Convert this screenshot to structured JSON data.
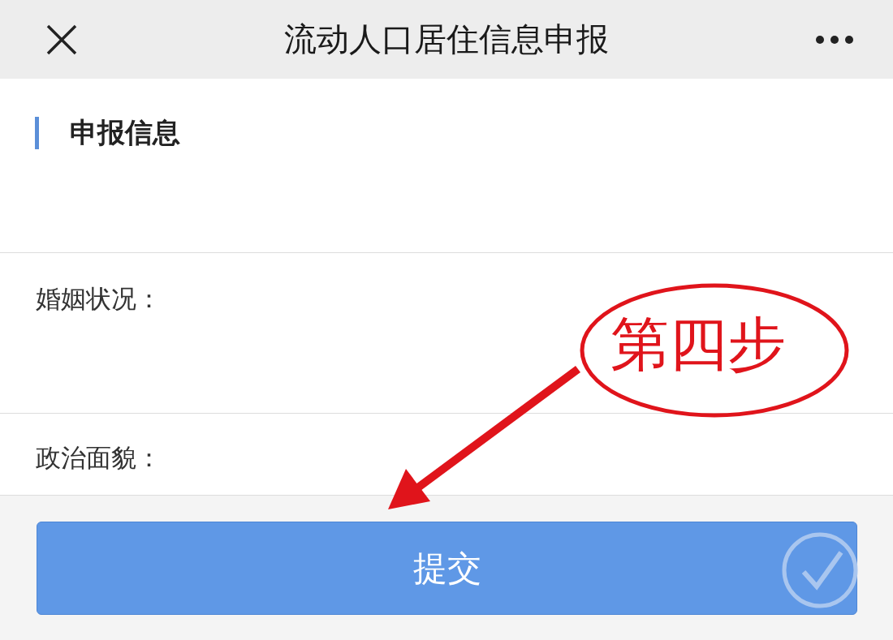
{
  "header": {
    "title": "流动人口居住信息申报"
  },
  "section": {
    "title": "申报信息"
  },
  "fields": [
    {
      "label": "婚姻状况："
    },
    {
      "label": "政治面貌："
    }
  ],
  "submit_button": {
    "label": "提交"
  },
  "annotation": {
    "text": "第四步"
  }
}
